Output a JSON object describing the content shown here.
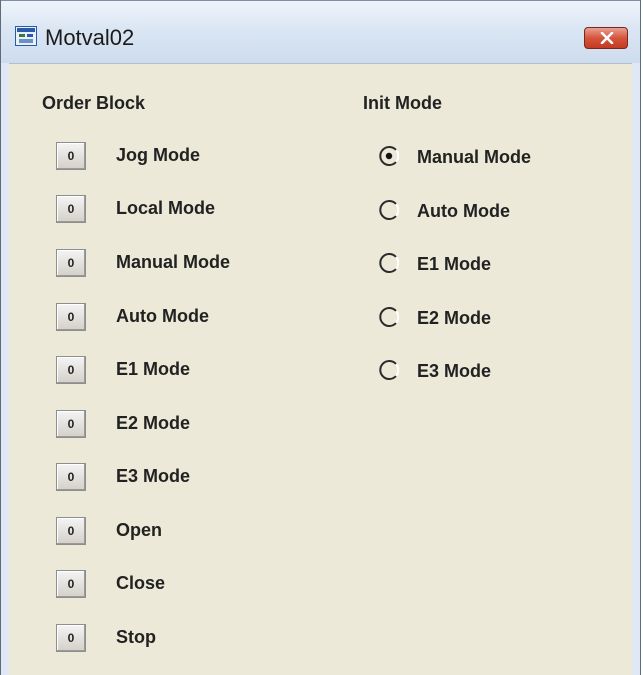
{
  "window": {
    "title": "Motval02",
    "icon": "app-window-icon",
    "close_icon": "close-x-icon",
    "accent_close": "#d6543c"
  },
  "order_block": {
    "title": "Order Block",
    "items": [
      {
        "button": "0",
        "label": "Jog Mode"
      },
      {
        "button": "0",
        "label": "Local Mode"
      },
      {
        "button": "0",
        "label": "Manual Mode"
      },
      {
        "button": "0",
        "label": "Auto Mode"
      },
      {
        "button": "0",
        "label": "E1 Mode"
      },
      {
        "button": "0",
        "label": "E2 Mode"
      },
      {
        "button": "0",
        "label": "E3 Mode"
      },
      {
        "button": "0",
        "label": "Open"
      },
      {
        "button": "0",
        "label": "Close"
      },
      {
        "button": "0",
        "label": "Stop"
      }
    ]
  },
  "init_mode": {
    "title": "Init Mode",
    "options": [
      {
        "label": "Manual Mode",
        "selected": true
      },
      {
        "label": "Auto Mode",
        "selected": false
      },
      {
        "label": "E1 Mode",
        "selected": false
      },
      {
        "label": "E2 Mode",
        "selected": false
      },
      {
        "label": "E3 Mode",
        "selected": false
      }
    ]
  }
}
